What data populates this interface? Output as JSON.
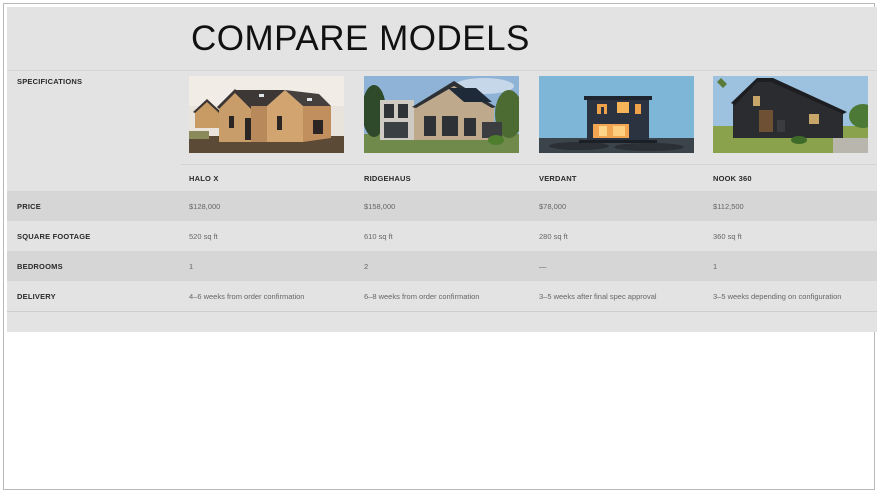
{
  "title": "COMPARE MODELS",
  "specifications_label": "SPECIFICATIONS",
  "models": [
    {
      "name": "HALO X",
      "image": "two-gable timber houses"
    },
    {
      "name": "RIDGEHAUS",
      "image": "modern house with solar roof"
    },
    {
      "name": "VERDANT",
      "image": "dark cube cabin at dusk"
    },
    {
      "name": "NOOK 360",
      "image": "black barn-style house"
    }
  ],
  "rows": [
    {
      "label": "PRICE",
      "values": [
        "$128,000",
        "$158,000",
        "$78,000",
        "$112,500"
      ]
    },
    {
      "label": "SQUARE FOOTAGE",
      "values": [
        "520 sq ft",
        "610 sq ft",
        "280 sq ft",
        "360 sq ft"
      ]
    },
    {
      "label": "BEDROOMS",
      "values": [
        "1",
        "2",
        "—",
        "1"
      ]
    },
    {
      "label": "DELIVERY",
      "values": [
        "4–6 weeks from order confirmation",
        "6–8 weeks from order confirmation",
        "3–5 weeks after final spec approval",
        "3–5 weeks depending on configuration"
      ]
    }
  ]
}
